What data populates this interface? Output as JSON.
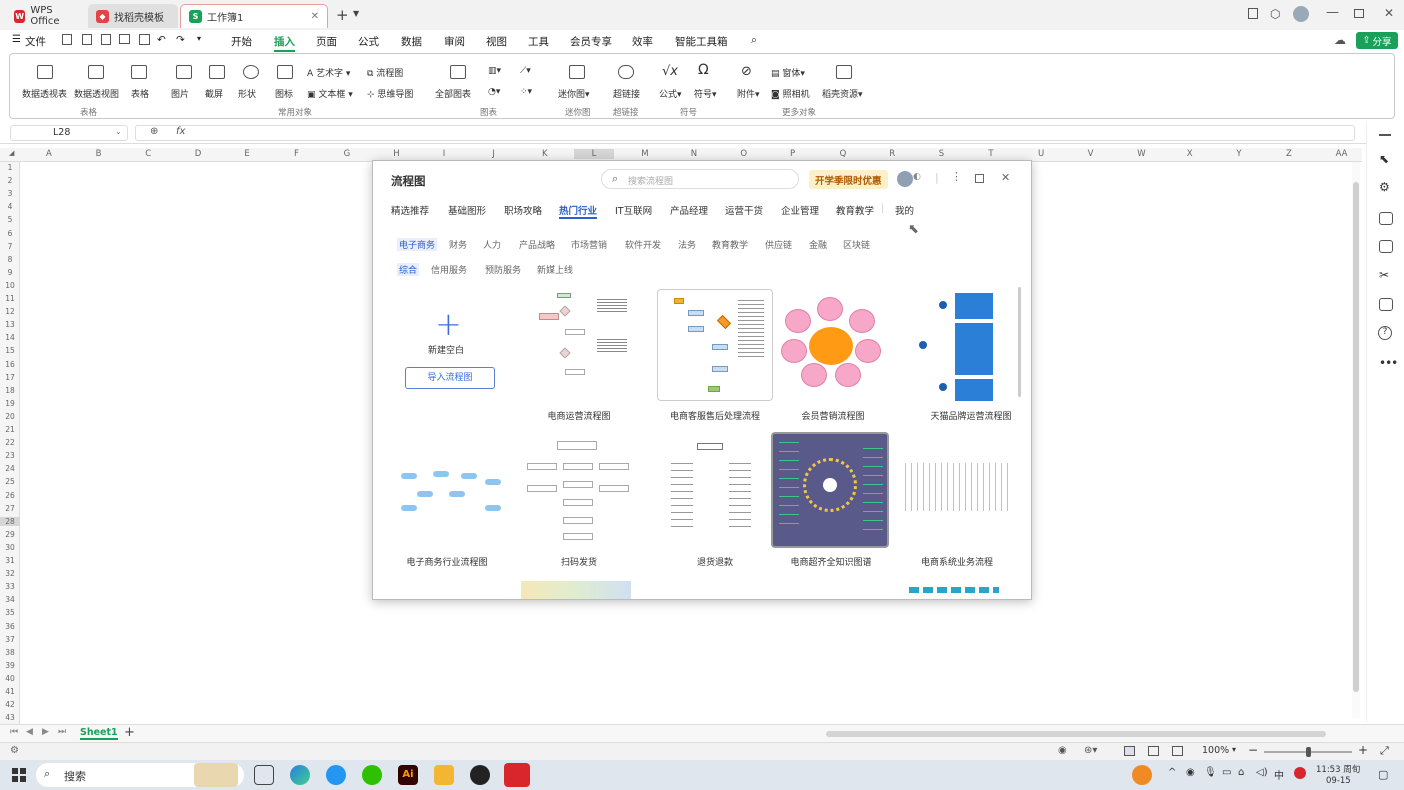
{
  "tabs": [
    {
      "label": "WPS Office"
    },
    {
      "label": "找稻壳模板"
    },
    {
      "label": "工作簿1"
    }
  ],
  "menu": [
    "文件",
    "开始",
    "插入",
    "页面",
    "公式",
    "数据",
    "审阅",
    "视图",
    "工具",
    "会员专享",
    "效率",
    "智能工具箱"
  ],
  "share_label": "分享",
  "ribbon": {
    "items": [
      {
        "label": "数据透视表"
      },
      {
        "label": "数据透视图"
      },
      {
        "label": "表格"
      },
      {
        "label": "图片"
      },
      {
        "label": "截屏"
      },
      {
        "label": "形状"
      },
      {
        "label": "图标"
      },
      {
        "label": "艺术字"
      },
      {
        "label": "文本框"
      },
      {
        "label": "流程图"
      },
      {
        "label": "思维导图"
      },
      {
        "label": "全部图表"
      },
      {
        "label": "迷你图"
      },
      {
        "label": "超链接"
      },
      {
        "label": "公式"
      },
      {
        "label": "符号"
      },
      {
        "label": "附件"
      },
      {
        "label": "窗体"
      },
      {
        "label": "照相机"
      },
      {
        "label": "稻壳资源"
      }
    ],
    "groups": [
      "表格",
      "常用对象",
      "图表",
      "迷你图",
      "超链接",
      "符号",
      "更多对象"
    ]
  },
  "formula": {
    "cell_ref": "L28",
    "fx": "fx"
  },
  "columns": [
    "A",
    "B",
    "C",
    "D",
    "E",
    "F",
    "G",
    "H",
    "I",
    "J",
    "K",
    "L",
    "M",
    "N",
    "O",
    "P",
    "Q",
    "R",
    "S",
    "T",
    "U",
    "V",
    "W",
    "X",
    "Y",
    "Z",
    "AA"
  ],
  "rows": [
    "1",
    "2",
    "3",
    "4",
    "5",
    "6",
    "7",
    "8",
    "9",
    "10",
    "11",
    "12",
    "13",
    "14",
    "15",
    "16",
    "17",
    "18",
    "19",
    "20",
    "21",
    "22",
    "23",
    "24",
    "25",
    "26",
    "27",
    "28",
    "29",
    "30",
    "31",
    "32",
    "33",
    "34",
    "35",
    "36",
    "37",
    "38",
    "39",
    "40",
    "41",
    "42",
    "43"
  ],
  "dialog": {
    "title": "流程图",
    "search_placeholder": "搜索流程图",
    "promo": "开学季限时优惠",
    "categories": [
      "精选推荐",
      "基础图形",
      "职场攻略",
      "热门行业",
      "IT互联网",
      "产品经理",
      "运营干货",
      "企业管理",
      "教育教学",
      "我的"
    ],
    "active_category": "热门行业",
    "subcategories_row1": [
      "电子商务",
      "财务",
      "人力",
      "产品战略",
      "市场营销",
      "软件开发",
      "法务",
      "教育教学",
      "供应链",
      "金融",
      "区块链"
    ],
    "subcategories_row2": [
      "综合",
      "信用服务",
      "预防服务",
      "新媒上线"
    ],
    "active_sub": "电子商务",
    "new_blank": "新建空白",
    "import_label": "导入流程图",
    "templates": [
      {
        "label": "电商运营流程图"
      },
      {
        "label": "电商客服售后处理流程"
      },
      {
        "label": "会员营销流程图"
      },
      {
        "label": "天猫品牌运营流程图"
      },
      {
        "label": "电子商务行业流程图"
      },
      {
        "label": "扫码发货"
      },
      {
        "label": "退货退款"
      },
      {
        "label": "电商超齐全知识图谱"
      },
      {
        "label": "电商系统业务流程"
      }
    ]
  },
  "sheet": {
    "name": "Sheet1"
  },
  "status": {
    "zoom": "100%"
  },
  "taskbar": {
    "search": "搜索",
    "time": "11:53 周旬",
    "date": "09-15",
    "ime": "中"
  },
  "colors": {
    "accent": "#1aa059",
    "active_blue": "#2b5fc9",
    "promo_bg": "#fdf0c8",
    "promo_text": "#b05a00"
  }
}
